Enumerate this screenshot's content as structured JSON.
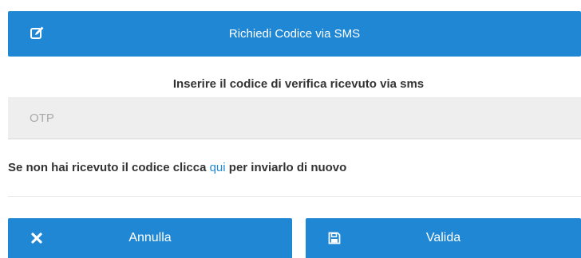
{
  "sms_request": {
    "label": "Richiedi Codice via SMS",
    "icon": "edit-icon"
  },
  "instruction": "Inserire il codice di verifica ricevuto via sms",
  "otp": {
    "placeholder": "OTP",
    "value": ""
  },
  "resend": {
    "prefix": "Se non hai ricevuto il codice clicca ",
    "link": "qui",
    "suffix": " per inviarlo di nuovo"
  },
  "actions": {
    "cancel": {
      "label": "Annulla",
      "icon": "close-icon"
    },
    "validate": {
      "label": "Valida",
      "icon": "save-icon"
    }
  },
  "colors": {
    "primary": "#1f87d3",
    "input_background": "#eeeeee",
    "text": "#333333"
  }
}
